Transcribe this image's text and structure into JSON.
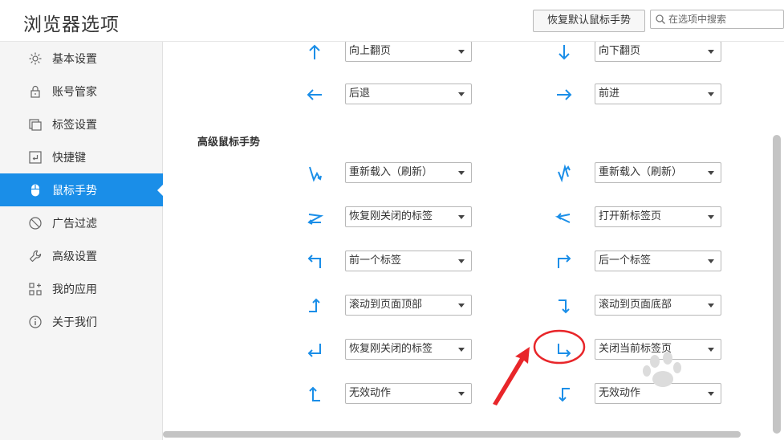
{
  "header": {
    "title": "浏览器选项",
    "restore_label": "恢复默认鼠标手势",
    "search_placeholder": "在选项中搜索"
  },
  "sidebar": {
    "items": [
      {
        "label": "基本设置",
        "icon": "gear-icon"
      },
      {
        "label": "账号管家",
        "icon": "lock-icon"
      },
      {
        "label": "标签设置",
        "icon": "tabs-icon"
      },
      {
        "label": "快捷键",
        "icon": "keyboard-icon"
      },
      {
        "label": "鼠标手势",
        "icon": "mouse-icon",
        "active": true
      },
      {
        "label": "广告过滤",
        "icon": "block-icon"
      },
      {
        "label": "高级设置",
        "icon": "wrench-icon"
      },
      {
        "label": "我的应用",
        "icon": "apps-icon"
      },
      {
        "label": "关于我们",
        "icon": "info-icon"
      }
    ]
  },
  "basic_gestures": [
    {
      "left": {
        "gesture": "up-arrow-icon",
        "action": "向上翻页"
      },
      "right": {
        "gesture": "down-arrow-icon",
        "action": "向下翻页"
      }
    },
    {
      "left": {
        "gesture": "left-arrow-icon",
        "action": "后退"
      },
      "right": {
        "gesture": "right-arrow-icon",
        "action": "前进"
      }
    }
  ],
  "advanced": {
    "title": "高级鼠标手势",
    "rows": [
      {
        "left": {
          "gesture": "down-up-gesture-icon",
          "action": "重新载入（刷新）"
        },
        "right": {
          "gesture": "up-down-gesture-icon",
          "action": "重新载入（刷新）"
        }
      },
      {
        "left": {
          "gesture": "right-left-gesture-icon",
          "action": "恢复刚关闭的标签"
        },
        "right": {
          "gesture": "left-right-gesture-icon",
          "action": "打开新标签页"
        }
      },
      {
        "left": {
          "gesture": "up-left-gesture-icon",
          "action": "前一个标签"
        },
        "right": {
          "gesture": "up-right-gesture-icon",
          "action": "后一个标签"
        }
      },
      {
        "left": {
          "gesture": "left-up-gesture-icon",
          "action": "滚动到页面顶部"
        },
        "right": {
          "gesture": "right-down-gesture-icon",
          "action": "滚动到页面底部"
        }
      },
      {
        "left": {
          "gesture": "down-left-gesture-icon",
          "action": "恢复刚关闭的标签"
        },
        "right": {
          "gesture": "down-right-gesture-icon",
          "action": "关闭当前标签页"
        }
      },
      {
        "left": {
          "gesture": "right-up-gesture-icon",
          "action": "无效动作"
        },
        "right": {
          "gesture": "right-down-alt-gesture-icon",
          "action": "无效动作"
        }
      }
    ]
  },
  "colors": {
    "accent": "#1a8ee8",
    "annotation": "#e8262a"
  }
}
